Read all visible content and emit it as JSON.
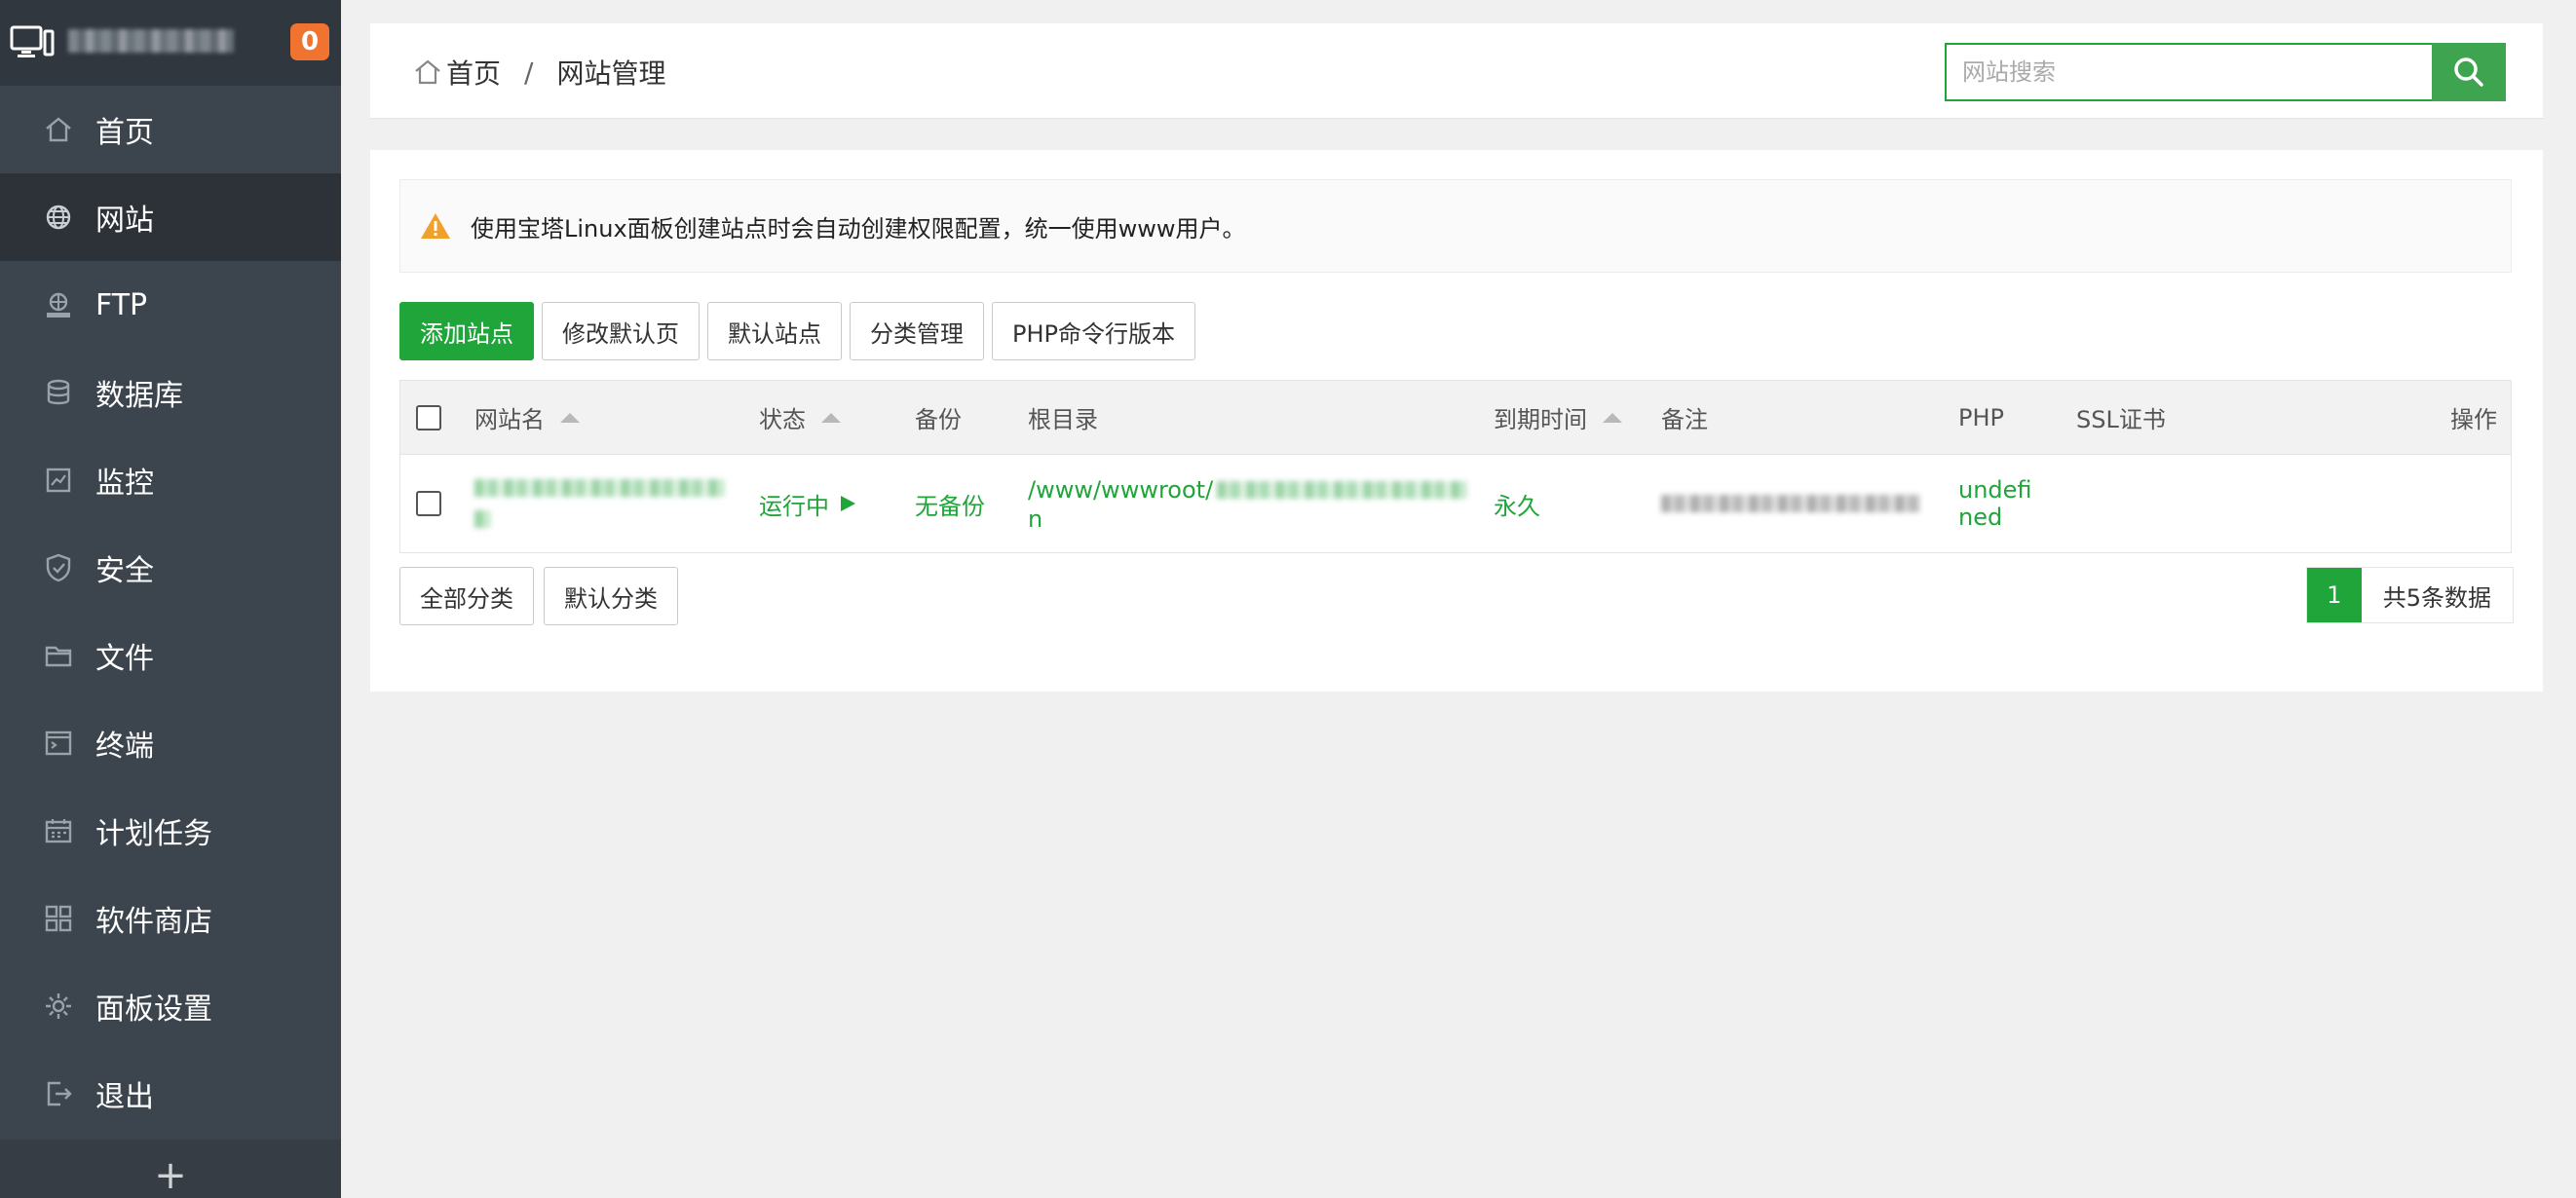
{
  "sidebar": {
    "server_ip": "",
    "notification_count": "0",
    "items": [
      {
        "label": "首页",
        "icon": "home-icon"
      },
      {
        "label": "网站",
        "icon": "globe-icon"
      },
      {
        "label": "FTP",
        "icon": "ftp-icon"
      },
      {
        "label": "数据库",
        "icon": "database-icon"
      },
      {
        "label": "监控",
        "icon": "monitor-chart-icon"
      },
      {
        "label": "安全",
        "icon": "shield-icon"
      },
      {
        "label": "文件",
        "icon": "folder-icon"
      },
      {
        "label": "终端",
        "icon": "terminal-icon"
      },
      {
        "label": "计划任务",
        "icon": "calendar-icon"
      },
      {
        "label": "软件商店",
        "icon": "grid-icon"
      },
      {
        "label": "面板设置",
        "icon": "gear-icon"
      },
      {
        "label": "退出",
        "icon": "logout-icon"
      }
    ],
    "active_index": 1,
    "add_label": "+"
  },
  "header": {
    "breadcrumb_home": "首页",
    "breadcrumb_sep": "/",
    "breadcrumb_current": "网站管理",
    "search_placeholder": "网站搜索"
  },
  "notice": "使用宝塔Linux面板创建站点时会自动创建权限配置，统一使用www用户。",
  "toolbar": {
    "add_site": "添加站点",
    "edit_default_page": "修改默认页",
    "default_site": "默认站点",
    "category_manage": "分类管理",
    "php_cli_version": "PHP命令行版本"
  },
  "table": {
    "columns": {
      "name": "网站名",
      "status": "状态",
      "backup": "备份",
      "root": "根目录",
      "expire": "到期时间",
      "remark": "备注",
      "php": "PHP",
      "ssl": "SSL证书",
      "actions": "操作"
    },
    "rows": [
      {
        "status": "运行中",
        "backup": "无备份",
        "root_prefix": "/www/wwwroot/",
        "root_suffix": "n",
        "expire": "永久",
        "php_line1": "undefi",
        "php_line2": "ned"
      }
    ]
  },
  "footer": {
    "all_categories": "全部分类",
    "default_category": "默认分类",
    "current_page": "1",
    "total": "共5条数据"
  },
  "colors": {
    "accent": "#20a53a",
    "sidebar_bg": "#3c444d",
    "badge": "#f0732f"
  }
}
